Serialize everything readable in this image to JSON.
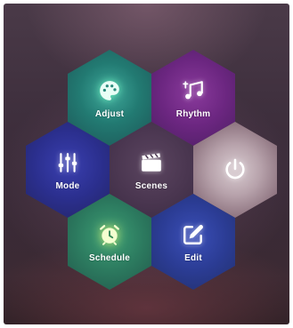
{
  "tiles": {
    "adjust": {
      "label": "Adjust",
      "icon": "palette-icon"
    },
    "rhythm": {
      "label": "Rhythm",
      "icon": "music-note-icon"
    },
    "mode": {
      "label": "Mode",
      "icon": "sliders-icon"
    },
    "scenes": {
      "label": "Scenes",
      "icon": "clapperboard-icon"
    },
    "power": {
      "label": "",
      "icon": "power-icon"
    },
    "schedule": {
      "label": "Schedule",
      "icon": "alarm-clock-icon"
    },
    "edit": {
      "label": "Edit",
      "icon": "edit-icon"
    }
  },
  "colors": {
    "adjust": "#227a72",
    "rhythm": "#6b2680",
    "mode": "#2b2f8e",
    "scenes": "#4a3650",
    "power": "#b7a2ab",
    "schedule": "#2c7a5f",
    "edit": "#2b3c94"
  }
}
